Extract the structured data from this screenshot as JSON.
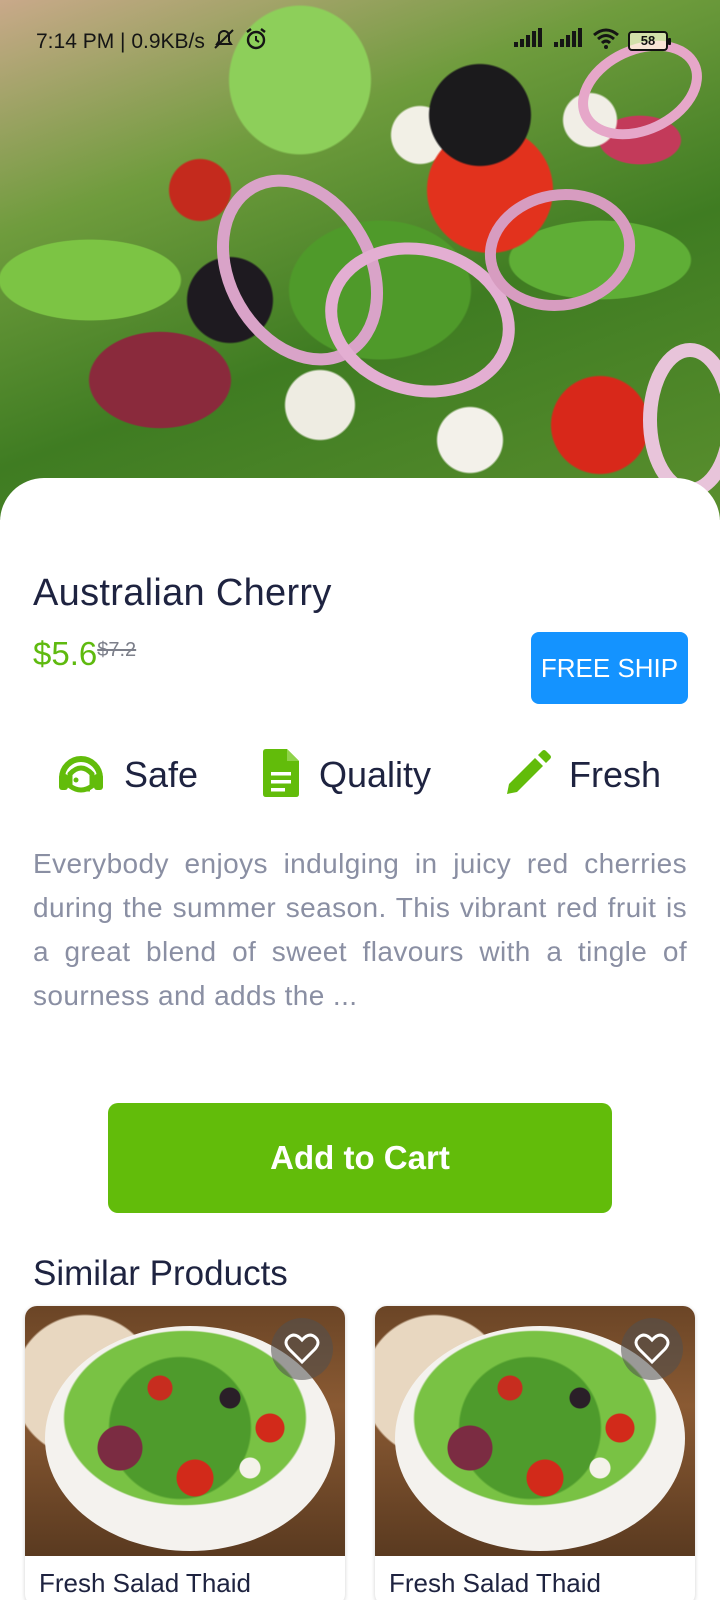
{
  "status_bar": {
    "time_speed": "7:14 PM | 0.9KB/s",
    "battery": "58"
  },
  "product": {
    "name": "Australian Cherry",
    "price": "$5.6",
    "old_price": "$7.2",
    "ship_badge": "FREE SHIP",
    "features": [
      {
        "label": "Safe",
        "icon": "headset-icon"
      },
      {
        "label": "Quality",
        "icon": "document-icon"
      },
      {
        "label": "Fresh",
        "icon": "pencil-icon"
      }
    ],
    "description": "Everybody enjoys indulging in juicy red cherries during the summer season. This vibrant red fruit is a great blend of sweet flavours with a tingle of sourness and adds the ...",
    "add_to_cart": "Add to Cart"
  },
  "similar": {
    "title": "Similar Products",
    "items": [
      {
        "name": "Fresh Salad Thaid"
      },
      {
        "name": "Fresh Salad Thaid"
      }
    ]
  },
  "colors": {
    "accent_green": "#62bc0a",
    "price_green": "#5fba0f",
    "ship_blue": "#1493ff",
    "feature_icon_green": "#62bc0a",
    "text_dark": "#1e2340",
    "text_muted": "#8a8fa3"
  }
}
